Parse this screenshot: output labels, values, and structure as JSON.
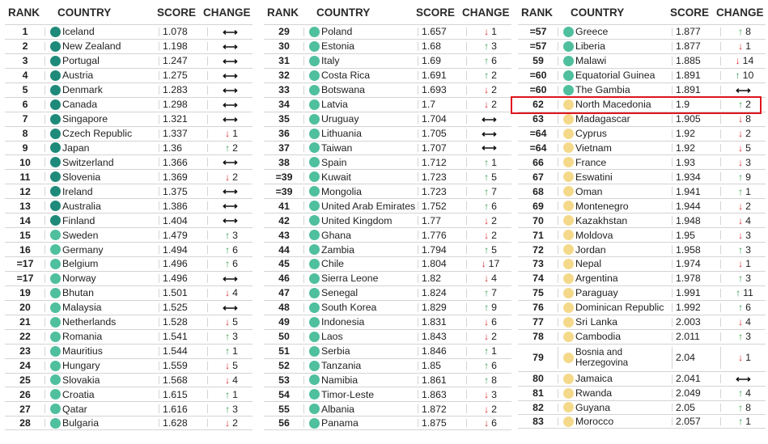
{
  "headers": {
    "rank": "RANK",
    "country": "COUNTRY",
    "score": "SCORE",
    "change": "CHANGE"
  },
  "colors": {
    "dark": "#1f8a79",
    "mid": "#4fbf9d",
    "light": "#f5d98a",
    "highlight": "#e0141e",
    "up": "#2e9a4a",
    "down": "#d9252b"
  },
  "icons": {
    "up": "arrow-up-icon",
    "down": "arrow-down-icon",
    "flat": "left-right-arrow-icon"
  },
  "columns": [
    [
      {
        "rank": "1",
        "country": "Iceland",
        "score": "1.078",
        "dir": "flat",
        "change": "",
        "tier": "dark"
      },
      {
        "rank": "2",
        "country": "New Zealand",
        "score": "1.198",
        "dir": "flat",
        "change": "",
        "tier": "dark"
      },
      {
        "rank": "3",
        "country": "Portugal",
        "score": "1.247",
        "dir": "flat",
        "change": "",
        "tier": "dark"
      },
      {
        "rank": "4",
        "country": "Austria",
        "score": "1.275",
        "dir": "flat",
        "change": "",
        "tier": "dark"
      },
      {
        "rank": "5",
        "country": "Denmark",
        "score": "1.283",
        "dir": "flat",
        "change": "",
        "tier": "dark"
      },
      {
        "rank": "6",
        "country": "Canada",
        "score": "1.298",
        "dir": "flat",
        "change": "",
        "tier": "dark"
      },
      {
        "rank": "7",
        "country": "Singapore",
        "score": "1.321",
        "dir": "flat",
        "change": "",
        "tier": "dark"
      },
      {
        "rank": "8",
        "country": "Czech Republic",
        "score": "1.337",
        "dir": "down",
        "change": "1",
        "tier": "dark"
      },
      {
        "rank": "9",
        "country": "Japan",
        "score": "1.36",
        "dir": "up",
        "change": "2",
        "tier": "dark"
      },
      {
        "rank": "10",
        "country": "Switzerland",
        "score": "1.366",
        "dir": "flat",
        "change": "",
        "tier": "dark"
      },
      {
        "rank": "11",
        "country": "Slovenia",
        "score": "1.369",
        "dir": "down",
        "change": "2",
        "tier": "dark"
      },
      {
        "rank": "12",
        "country": "Ireland",
        "score": "1.375",
        "dir": "flat",
        "change": "",
        "tier": "dark"
      },
      {
        "rank": "13",
        "country": "Australia",
        "score": "1.386",
        "dir": "flat",
        "change": "",
        "tier": "dark"
      },
      {
        "rank": "14",
        "country": "Finland",
        "score": "1.404",
        "dir": "flat",
        "change": "",
        "tier": "dark"
      },
      {
        "rank": "15",
        "country": "Sweden",
        "score": "1.479",
        "dir": "up",
        "change": "3",
        "tier": "mid"
      },
      {
        "rank": "16",
        "country": "Germany",
        "score": "1.494",
        "dir": "up",
        "change": "6",
        "tier": "mid"
      },
      {
        "rank": "=17",
        "country": "Belgium",
        "score": "1.496",
        "dir": "up",
        "change": "6",
        "tier": "mid"
      },
      {
        "rank": "=17",
        "country": "Norway",
        "score": "1.496",
        "dir": "flat",
        "change": "",
        "tier": "mid"
      },
      {
        "rank": "19",
        "country": "Bhutan",
        "score": "1.501",
        "dir": "down",
        "change": "4",
        "tier": "mid"
      },
      {
        "rank": "20",
        "country": "Malaysia",
        "score": "1.525",
        "dir": "flat",
        "change": "",
        "tier": "mid"
      },
      {
        "rank": "21",
        "country": "Netherlands",
        "score": "1.528",
        "dir": "down",
        "change": "5",
        "tier": "mid"
      },
      {
        "rank": "22",
        "country": "Romania",
        "score": "1.541",
        "dir": "up",
        "change": "3",
        "tier": "mid"
      },
      {
        "rank": "23",
        "country": "Mauritius",
        "score": "1.544",
        "dir": "up",
        "change": "1",
        "tier": "mid"
      },
      {
        "rank": "24",
        "country": "Hungary",
        "score": "1.559",
        "dir": "down",
        "change": "5",
        "tier": "mid"
      },
      {
        "rank": "25",
        "country": "Slovakia",
        "score": "1.568",
        "dir": "down",
        "change": "4",
        "tier": "mid"
      },
      {
        "rank": "26",
        "country": "Croatia",
        "score": "1.615",
        "dir": "up",
        "change": "1",
        "tier": "mid"
      },
      {
        "rank": "27",
        "country": "Qatar",
        "score": "1.616",
        "dir": "up",
        "change": "3",
        "tier": "mid"
      },
      {
        "rank": "28",
        "country": "Bulgaria",
        "score": "1.628",
        "dir": "down",
        "change": "2",
        "tier": "mid"
      }
    ],
    [
      {
        "rank": "29",
        "country": "Poland",
        "score": "1.657",
        "dir": "down",
        "change": "1",
        "tier": "mid"
      },
      {
        "rank": "30",
        "country": "Estonia",
        "score": "1.68",
        "dir": "up",
        "change": "3",
        "tier": "mid"
      },
      {
        "rank": "31",
        "country": "Italy",
        "score": "1.69",
        "dir": "up",
        "change": "6",
        "tier": "mid"
      },
      {
        "rank": "32",
        "country": "Costa Rica",
        "score": "1.691",
        "dir": "up",
        "change": "2",
        "tier": "mid"
      },
      {
        "rank": "33",
        "country": "Botswana",
        "score": "1.693",
        "dir": "down",
        "change": "2",
        "tier": "mid"
      },
      {
        "rank": "34",
        "country": "Latvia",
        "score": "1.7",
        "dir": "down",
        "change": "2",
        "tier": "mid"
      },
      {
        "rank": "35",
        "country": "Uruguay",
        "score": "1.704",
        "dir": "flat",
        "change": "",
        "tier": "mid"
      },
      {
        "rank": "36",
        "country": "Lithuania",
        "score": "1.705",
        "dir": "flat",
        "change": "",
        "tier": "mid"
      },
      {
        "rank": "37",
        "country": "Taiwan",
        "score": "1.707",
        "dir": "flat",
        "change": "",
        "tier": "mid"
      },
      {
        "rank": "38",
        "country": "Spain",
        "score": "1.712",
        "dir": "up",
        "change": "1",
        "tier": "mid"
      },
      {
        "rank": "=39",
        "country": "Kuwait",
        "score": "1.723",
        "dir": "up",
        "change": "5",
        "tier": "mid"
      },
      {
        "rank": "=39",
        "country": "Mongolia",
        "score": "1.723",
        "dir": "up",
        "change": "7",
        "tier": "mid"
      },
      {
        "rank": "41",
        "country": "United Arab Emirates",
        "score": "1.752",
        "dir": "up",
        "change": "6",
        "tier": "mid"
      },
      {
        "rank": "42",
        "country": "United Kingdom",
        "score": "1.77",
        "dir": "down",
        "change": "2",
        "tier": "mid"
      },
      {
        "rank": "43",
        "country": "Ghana",
        "score": "1.776",
        "dir": "down",
        "change": "2",
        "tier": "mid"
      },
      {
        "rank": "44",
        "country": "Zambia",
        "score": "1.794",
        "dir": "up",
        "change": "5",
        "tier": "mid"
      },
      {
        "rank": "45",
        "country": "Chile",
        "score": "1.804",
        "dir": "down",
        "change": "17",
        "tier": "mid"
      },
      {
        "rank": "46",
        "country": "Sierra Leone",
        "score": "1.82",
        "dir": "down",
        "change": "4",
        "tier": "mid"
      },
      {
        "rank": "47",
        "country": "Senegal",
        "score": "1.824",
        "dir": "up",
        "change": "7",
        "tier": "mid"
      },
      {
        "rank": "48",
        "country": "South Korea",
        "score": "1.829",
        "dir": "up",
        "change": "9",
        "tier": "mid"
      },
      {
        "rank": "49",
        "country": "Indonesia",
        "score": "1.831",
        "dir": "down",
        "change": "6",
        "tier": "mid"
      },
      {
        "rank": "50",
        "country": "Laos",
        "score": "1.843",
        "dir": "down",
        "change": "2",
        "tier": "mid"
      },
      {
        "rank": "51",
        "country": "Serbia",
        "score": "1.846",
        "dir": "up",
        "change": "1",
        "tier": "mid"
      },
      {
        "rank": "52",
        "country": "Tanzania",
        "score": "1.85",
        "dir": "up",
        "change": "6",
        "tier": "mid"
      },
      {
        "rank": "53",
        "country": "Namibia",
        "score": "1.861",
        "dir": "up",
        "change": "8",
        "tier": "mid"
      },
      {
        "rank": "54",
        "country": "Timor-Leste",
        "score": "1.863",
        "dir": "down",
        "change": "3",
        "tier": "mid"
      },
      {
        "rank": "55",
        "country": "Albania",
        "score": "1.872",
        "dir": "down",
        "change": "2",
        "tier": "mid"
      },
      {
        "rank": "56",
        "country": "Panama",
        "score": "1.875",
        "dir": "down",
        "change": "6",
        "tier": "mid"
      }
    ],
    [
      {
        "rank": "=57",
        "country": "Greece",
        "score": "1.877",
        "dir": "up",
        "change": "8",
        "tier": "mid"
      },
      {
        "rank": "=57",
        "country": "Liberia",
        "score": "1.877",
        "dir": "down",
        "change": "1",
        "tier": "mid"
      },
      {
        "rank": "59",
        "country": "Malawi",
        "score": "1.885",
        "dir": "down",
        "change": "14",
        "tier": "mid"
      },
      {
        "rank": "=60",
        "country": "Equatorial Guinea",
        "score": "1.891",
        "dir": "up",
        "change": "10",
        "tier": "mid"
      },
      {
        "rank": "=60",
        "country": "The Gambia",
        "score": "1.891",
        "dir": "flat",
        "change": "",
        "tier": "mid"
      },
      {
        "rank": "62",
        "country": "North Macedonia",
        "score": "1.9",
        "dir": "up",
        "change": "2",
        "tier": "light"
      },
      {
        "rank": "63",
        "country": "Madagascar",
        "score": "1.905",
        "dir": "down",
        "change": "8",
        "tier": "light"
      },
      {
        "rank": "=64",
        "country": "Cyprus",
        "score": "1.92",
        "dir": "down",
        "change": "2",
        "tier": "light"
      },
      {
        "rank": "=64",
        "country": "Vietnam",
        "score": "1.92",
        "dir": "down",
        "change": "5",
        "tier": "light"
      },
      {
        "rank": "66",
        "country": "France",
        "score": "1.93",
        "dir": "down",
        "change": "3",
        "tier": "light"
      },
      {
        "rank": "67",
        "country": "Eswatini",
        "score": "1.934",
        "dir": "up",
        "change": "9",
        "tier": "light"
      },
      {
        "rank": "68",
        "country": "Oman",
        "score": "1.941",
        "dir": "up",
        "change": "1",
        "tier": "light"
      },
      {
        "rank": "69",
        "country": "Montenegro",
        "score": "1.944",
        "dir": "down",
        "change": "2",
        "tier": "light"
      },
      {
        "rank": "70",
        "country": "Kazakhstan",
        "score": "1.948",
        "dir": "down",
        "change": "4",
        "tier": "light"
      },
      {
        "rank": "71",
        "country": "Moldova",
        "score": "1.95",
        "dir": "down",
        "change": "3",
        "tier": "light"
      },
      {
        "rank": "72",
        "country": "Jordan",
        "score": "1.958",
        "dir": "up",
        "change": "3",
        "tier": "light"
      },
      {
        "rank": "73",
        "country": "Nepal",
        "score": "1.974",
        "dir": "down",
        "change": "1",
        "tier": "light"
      },
      {
        "rank": "74",
        "country": "Argentina",
        "score": "1.978",
        "dir": "up",
        "change": "3",
        "tier": "light"
      },
      {
        "rank": "75",
        "country": "Paraguay",
        "score": "1.991",
        "dir": "up",
        "change": "11",
        "tier": "light"
      },
      {
        "rank": "76",
        "country": "Dominican Republic",
        "score": "1.992",
        "dir": "up",
        "change": "6",
        "tier": "light"
      },
      {
        "rank": "77",
        "country": "Sri Lanka",
        "score": "2.003",
        "dir": "down",
        "change": "4",
        "tier": "light"
      },
      {
        "rank": "78",
        "country": "Cambodia",
        "score": "2.011",
        "dir": "up",
        "change": "3",
        "tier": "light"
      },
      {
        "rank": "79",
        "country": "Bosnia and Herzegovina",
        "score": "2.04",
        "dir": "down",
        "change": "1",
        "tier": "light",
        "tall": true
      },
      {
        "rank": "80",
        "country": "Jamaica",
        "score": "2.041",
        "dir": "flat",
        "change": "",
        "tier": "light"
      },
      {
        "rank": "81",
        "country": "Rwanda",
        "score": "2.049",
        "dir": "up",
        "change": "4",
        "tier": "light"
      },
      {
        "rank": "82",
        "country": "Guyana",
        "score": "2.05",
        "dir": "up",
        "change": "8",
        "tier": "light"
      },
      {
        "rank": "83",
        "country": "Morocco",
        "score": "2.057",
        "dir": "up",
        "change": "1",
        "tier": "light"
      }
    ]
  ]
}
